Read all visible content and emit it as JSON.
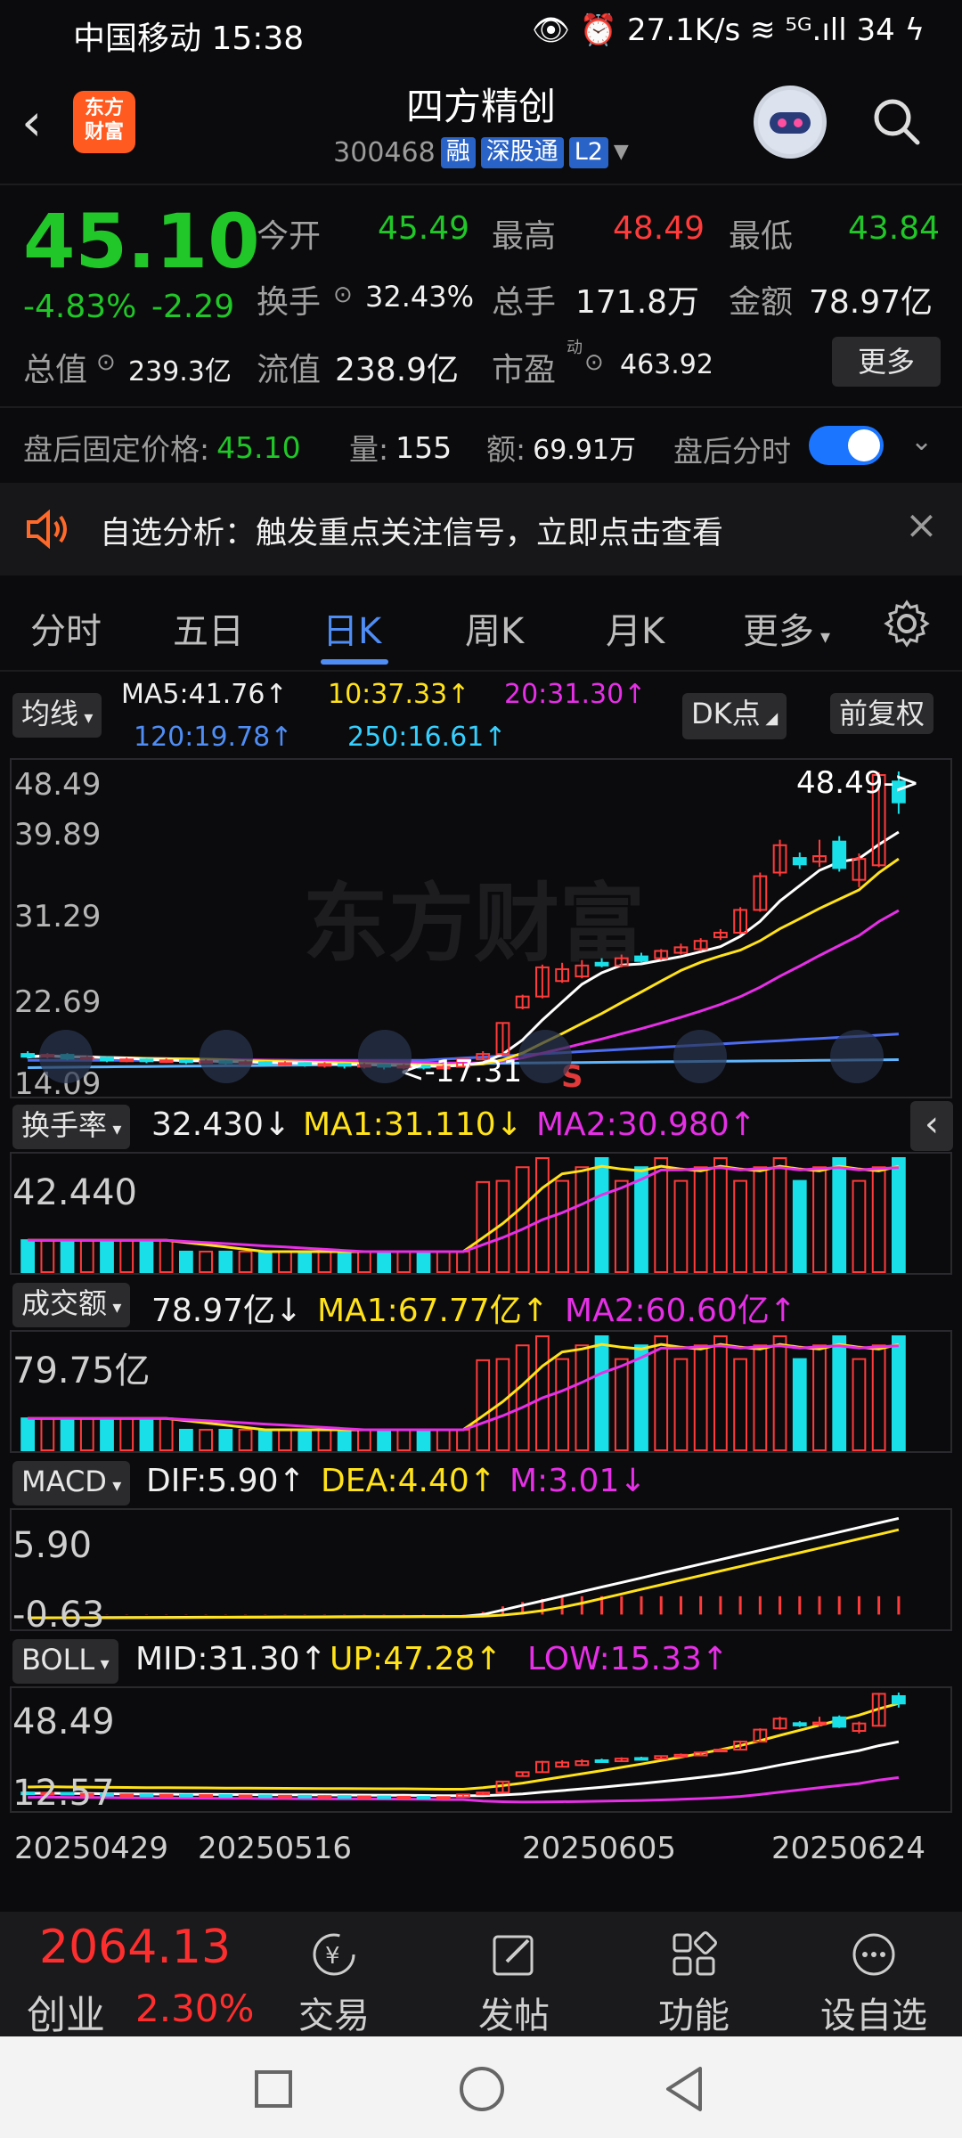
{
  "status_bar": {
    "time": "中国移动 15:38",
    "right": "👁 ⏰ 27.1K/s  ≋ ⁵ᴳ.ıll  34 ϟ"
  },
  "header": {
    "back_icon": "chevron-left",
    "logo_line1": "东方",
    "logo_line2": "财富",
    "stock_name": "四方精创",
    "stock_code": "300468",
    "tag_rong": "融",
    "tag_sgt": "深股通",
    "tag_l2": "L2"
  },
  "quote": {
    "price": "45.10",
    "change_pct": "-4.83%",
    "change": "-2.29",
    "open_label": "今开",
    "open": "45.49",
    "high_label": "最高",
    "high": "48.49",
    "low_label": "最低",
    "low": "43.84",
    "turnover_label": "换手",
    "turnover": "32.43%",
    "volume_label": "总手",
    "volume": "171.8万",
    "amount_label": "金额",
    "amount": "78.97亿",
    "total_mv_label": "总值",
    "total_mv": "239.3亿",
    "float_mv_label": "流值",
    "float_mv": "238.9亿",
    "pe_label": "市盈",
    "pe_sup": "动",
    "pe": "463.92",
    "more_button": "更多"
  },
  "after_hours": {
    "fixed_price_label": "盘后固定价格:",
    "fixed_price": "45.10",
    "qty_label": "量:",
    "qty": "155",
    "amt_label": "额:",
    "amt": "69.91万",
    "toggle_label": "盘后分时",
    "toggle_on": true
  },
  "banner": {
    "text": "自选分析：触发重点关注信号，立即点击查看"
  },
  "tabs": [
    "分时",
    "五日",
    "日K",
    "周K",
    "月K",
    "更多"
  ],
  "active_tab": "日K",
  "ma_panel": {
    "selector": "均线",
    "ma5": "MA5:41.76↑",
    "ma10": "10:37.33↑",
    "ma20": "20:31.30↑",
    "ma120": "120:19.78↑",
    "ma250": "250:16.61↑",
    "dk_button": "DK点",
    "fq_button": "前复权"
  },
  "chart_labels": {
    "price_ticks": [
      "48.49",
      "39.89",
      "31.29",
      "22.69",
      "14.09"
    ],
    "high_marker": "48.49->",
    "low_marker": "<-17.31",
    "s_marker": "S",
    "turnover_selector": "换手率",
    "turnover_val": "32.430↓",
    "turnover_ma1": "MA1:31.110↓",
    "turnover_ma2": "MA2:30.980↑",
    "turnover_axis": "42.440",
    "vol_selector": "成交额",
    "vol_val": "78.97亿↓",
    "vol_ma1": "MA1:67.77亿↑",
    "vol_ma2": "MA2:60.60亿↑",
    "vol_axis": "79.75亿",
    "macd_selector": "MACD",
    "macd_dif": "DIF:5.90↑",
    "macd_dea": "DEA:4.40↑",
    "macd_m": "M:3.01↓",
    "macd_top": "5.90",
    "macd_bottom": "-0.63",
    "boll_selector": "BOLL",
    "boll_mid": "MID:31.30↑",
    "boll_up": "UP:47.28↑",
    "boll_low": "LOW:15.33↑",
    "boll_top": "48.49",
    "boll_bottom": "12.57",
    "dates": [
      "20250429",
      "20250516",
      "20250605",
      "20250624"
    ],
    "watermark": "东方财富"
  },
  "chart_data": {
    "type": "candlestick",
    "y_range": [
      14.09,
      48.49
    ],
    "candles": [
      {
        "o": 17.5,
        "c": 17.2,
        "h": 17.8,
        "l": 17.0
      },
      {
        "o": 17.2,
        "c": 17.4,
        "h": 17.6,
        "l": 17.0
      },
      {
        "o": 17.4,
        "c": 17.0,
        "h": 17.6,
        "l": 16.8
      },
      {
        "o": 17.0,
        "c": 17.1,
        "h": 17.3,
        "l": 16.8
      },
      {
        "o": 17.1,
        "c": 16.8,
        "h": 17.2,
        "l": 16.6
      },
      {
        "o": 16.8,
        "c": 16.9,
        "h": 17.1,
        "l": 16.6
      },
      {
        "o": 16.9,
        "c": 16.7,
        "h": 17.0,
        "l": 16.5
      },
      {
        "o": 16.7,
        "c": 16.8,
        "h": 17.0,
        "l": 16.5
      },
      {
        "o": 16.8,
        "c": 16.6,
        "h": 16.9,
        "l": 16.4
      },
      {
        "o": 16.6,
        "c": 16.7,
        "h": 16.9,
        "l": 16.4
      },
      {
        "o": 16.7,
        "c": 16.5,
        "h": 16.8,
        "l": 16.3
      },
      {
        "o": 16.5,
        "c": 16.6,
        "h": 16.8,
        "l": 16.3
      },
      {
        "o": 16.6,
        "c": 16.4,
        "h": 16.7,
        "l": 16.2
      },
      {
        "o": 16.4,
        "c": 16.5,
        "h": 16.7,
        "l": 16.2
      },
      {
        "o": 16.5,
        "c": 16.3,
        "h": 16.6,
        "l": 16.1
      },
      {
        "o": 16.3,
        "c": 16.4,
        "h": 16.6,
        "l": 16.0
      },
      {
        "o": 16.4,
        "c": 16.2,
        "h": 16.5,
        "l": 15.9
      },
      {
        "o": 16.2,
        "c": 16.3,
        "h": 16.5,
        "l": 15.9
      },
      {
        "o": 16.3,
        "c": 16.1,
        "h": 16.4,
        "l": 15.8
      },
      {
        "o": 16.1,
        "c": 16.2,
        "h": 16.4,
        "l": 15.8
      },
      {
        "o": 16.2,
        "c": 16.0,
        "h": 16.3,
        "l": 15.8
      },
      {
        "o": 16.0,
        "c": 16.1,
        "h": 16.3,
        "l": 15.8
      },
      {
        "o": 16.1,
        "c": 16.9,
        "h": 17.0,
        "l": 16.0
      },
      {
        "o": 16.9,
        "c": 17.5,
        "h": 17.8,
        "l": 16.8
      },
      {
        "o": 17.5,
        "c": 20.9,
        "h": 20.9,
        "l": 17.3
      },
      {
        "o": 22.6,
        "c": 23.8,
        "h": 24.0,
        "l": 22.4
      },
      {
        "o": 23.8,
        "c": 27.0,
        "h": 27.3,
        "l": 23.6
      },
      {
        "o": 25.5,
        "c": 26.8,
        "h": 27.5,
        "l": 25.3
      },
      {
        "o": 26.0,
        "c": 27.2,
        "h": 27.8,
        "l": 25.8
      },
      {
        "o": 27.5,
        "c": 27.2,
        "h": 28.0,
        "l": 27.0
      },
      {
        "o": 27.2,
        "c": 28.0,
        "h": 28.4,
        "l": 27.0
      },
      {
        "o": 28.2,
        "c": 27.7,
        "h": 28.6,
        "l": 27.5
      },
      {
        "o": 28.0,
        "c": 28.8,
        "h": 29.0,
        "l": 27.8
      },
      {
        "o": 28.6,
        "c": 29.2,
        "h": 29.6,
        "l": 28.4
      },
      {
        "o": 29.0,
        "c": 29.9,
        "h": 30.2,
        "l": 28.8
      },
      {
        "o": 30.3,
        "c": 30.8,
        "h": 31.2,
        "l": 30.0
      },
      {
        "o": 30.8,
        "c": 33.3,
        "h": 33.6,
        "l": 30.6
      },
      {
        "o": 33.3,
        "c": 37.0,
        "h": 37.4,
        "l": 33.1
      },
      {
        "o": 37.4,
        "c": 40.4,
        "h": 41.0,
        "l": 37.0
      },
      {
        "o": 39.0,
        "c": 38.3,
        "h": 39.6,
        "l": 37.8
      },
      {
        "o": 38.6,
        "c": 39.2,
        "h": 41.0,
        "l": 38.0
      },
      {
        "o": 40.8,
        "c": 37.9,
        "h": 41.4,
        "l": 37.5
      },
      {
        "o": 36.6,
        "c": 38.9,
        "h": 39.5,
        "l": 35.8
      },
      {
        "o": 38.2,
        "c": 48.1,
        "h": 48.4,
        "l": 38.0
      },
      {
        "o": 47.39,
        "c": 45.1,
        "h": 48.49,
        "l": 43.84
      }
    ]
  },
  "bottom_bar": {
    "index_value": "2064.13",
    "index_name": "创业",
    "index_change": "2.30%",
    "items": [
      "交易",
      "发帖",
      "功能",
      "设自选"
    ]
  }
}
